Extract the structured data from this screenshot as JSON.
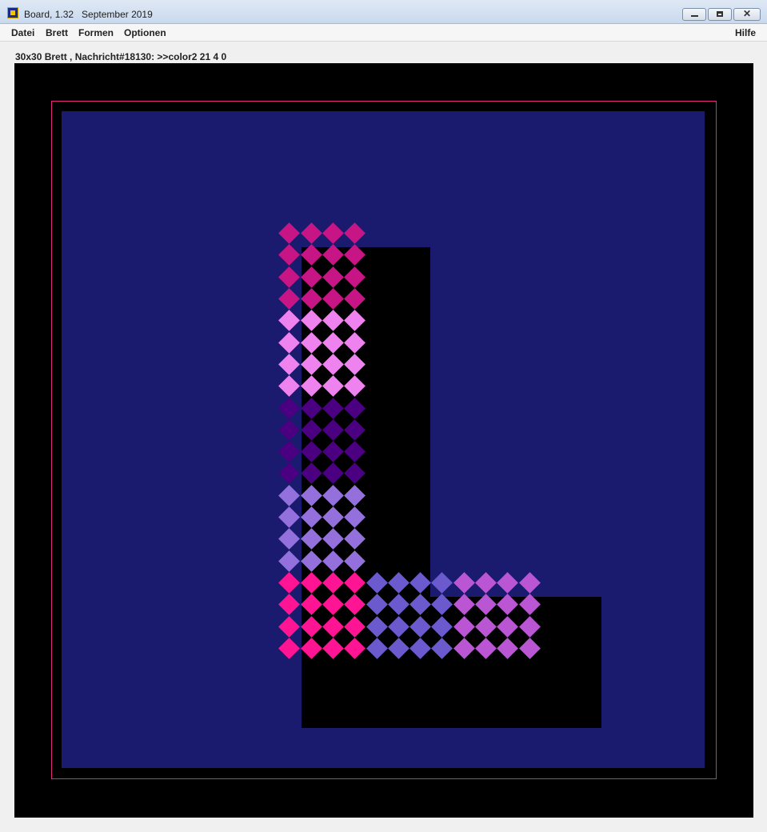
{
  "window": {
    "title": "Board, 1.32   September 2019",
    "minimize_label": "",
    "maximize_label": "",
    "close_label": "✕"
  },
  "menu": {
    "left": [
      "Datei",
      "Brett",
      "Formen",
      "Optionen"
    ],
    "right": "Hilfe"
  },
  "status_line": "30x30 Brett , Nachricht#18130: >>color2 21 4 0",
  "board": {
    "size": "30x30",
    "colors": {
      "background": "#000000",
      "border_line": "#e0287c",
      "field": "#1a1a6e",
      "empty_shape": "#000000"
    },
    "pieces": [
      {
        "cols": [
          11,
          14
        ],
        "rows": [
          7,
          10
        ],
        "color": "#c71585"
      },
      {
        "cols": [
          11,
          14
        ],
        "rows": [
          11,
          14
        ],
        "color": "#ee82ee"
      },
      {
        "cols": [
          11,
          14
        ],
        "rows": [
          15,
          18
        ],
        "color": "#4b0082"
      },
      {
        "cols": [
          11,
          14
        ],
        "rows": [
          19,
          22
        ],
        "color": "#9370db"
      },
      {
        "cols": [
          11,
          14
        ],
        "rows": [
          23,
          26
        ],
        "color": "#ff1493"
      },
      {
        "cols": [
          15,
          18
        ],
        "rows": [
          23,
          26
        ],
        "color": "#6a5acd"
      },
      {
        "cols": [
          19,
          22
        ],
        "rows": [
          23,
          26
        ],
        "color": "#ba55d3"
      }
    ]
  }
}
